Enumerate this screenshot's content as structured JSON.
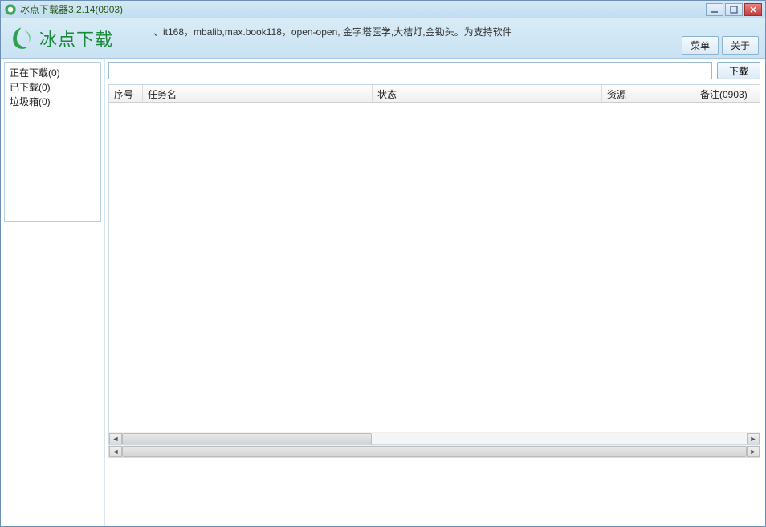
{
  "window": {
    "title": "冰点下载器3.2.14(0903)"
  },
  "logo": {
    "text": "冰点下载"
  },
  "header": {
    "info": "、it168，mbalib,max.book118，open-open, 金字塔医学,大桔灯,金锄头。为支持软件",
    "menu_label": "菜单",
    "about_label": "关于"
  },
  "sidebar": {
    "items": [
      {
        "label": "正在下载(0)"
      },
      {
        "label": "已下载(0)"
      },
      {
        "label": "垃圾箱(0)"
      }
    ]
  },
  "urlbar": {
    "value": "",
    "placeholder": "",
    "download_label": "下载"
  },
  "table": {
    "columns": {
      "no": "序号",
      "name": "任务名",
      "status": "状态",
      "res": "资源",
      "note": "备注(0903)"
    },
    "rows": []
  }
}
